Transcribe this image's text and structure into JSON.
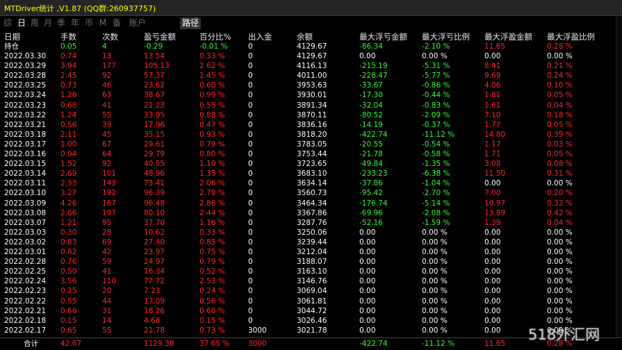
{
  "title": "MTDriver统计 ,V1.87 (QQ群:260937757)",
  "tabs": [
    "综",
    "日",
    "周",
    "月",
    "季",
    "年",
    "币",
    "M",
    "备",
    "账户",
    "路径"
  ],
  "active_tab": "日",
  "headers": [
    "日期",
    "手数",
    "次数",
    "盈亏金额",
    "百分比%",
    "出入金",
    "余额",
    "最大浮亏金额",
    "最大浮亏比例",
    "最大浮盈金额",
    "最大浮盈比例"
  ],
  "holding": [
    "持仓",
    "0.05",
    "4",
    "-0.29",
    "-0.01 %",
    "0",
    "4129.67",
    "-86.34",
    "-2.10 %",
    "11.65",
    "0.28 %"
  ],
  "rows": [
    [
      "2022.03.30",
      "0.74",
      "13",
      "13.54",
      "0.33 %",
      "0",
      "4129.67",
      "0.00",
      "0.00 %",
      "0.00",
      "0.00 %"
    ],
    [
      "2022.03.29",
      "3.94",
      "177",
      "105.13",
      "2.62 %",
      "0",
      "4116.13",
      "-215.19",
      "-5.31 %",
      "8.41",
      "0.21 %"
    ],
    [
      "2022.03.28",
      "2.45",
      "92",
      "57.37",
      "1.45 %",
      "0",
      "4011.00",
      "-228.47",
      "-5.77 %",
      "9.69",
      "0.24 %"
    ],
    [
      "2022.03.25",
      "0.73",
      "46",
      "23.62",
      "0.60 %",
      "0",
      "3953.63",
      "-33.67",
      "-0.86 %",
      "4.06",
      "0.10 %"
    ],
    [
      "2022.03.24",
      "1.26",
      "63",
      "38.67",
      "0.99 %",
      "0",
      "3930.01",
      "-17.30",
      "-0.44 %",
      "1.81",
      "0.05 %"
    ],
    [
      "2022.03.23",
      "0.68",
      "41",
      "21.23",
      "0.55 %",
      "0",
      "3891.34",
      "-32.04",
      "-0.83 %",
      "1.61",
      "0.04 %"
    ],
    [
      "2022.03.22",
      "1.24",
      "55",
      "33.95",
      "0.88 %",
      "0",
      "3870.11",
      "-80.52",
      "-2.09 %",
      "7.10",
      "0.18 %"
    ],
    [
      "2022.03.21",
      "0.56",
      "39",
      "17.96",
      "0.47 %",
      "0",
      "3836.16",
      "-14.19",
      "-0.37 %",
      "1.77",
      "0.05 %"
    ],
    [
      "2022.03.18",
      "2.11",
      "45",
      "35.15",
      "0.93 %",
      "0",
      "3818.20",
      "-422.74",
      "-11.12 %",
      "14.80",
      "0.39 %"
    ],
    [
      "2022.03.17",
      "1.00",
      "67",
      "29.61",
      "0.79 %",
      "0",
      "3783.05",
      "-20.55",
      "-0.54 %",
      "1.17",
      "0.03 %"
    ],
    [
      "2022.03.16",
      "0.94",
      "64",
      "29.79",
      "0.80 %",
      "0",
      "3753.44",
      "-21.78",
      "-0.58 %",
      "1.71",
      "0.05 %"
    ],
    [
      "2022.03.15",
      "1.52",
      "92",
      "40.55",
      "1.10 %",
      "0",
      "3723.65",
      "-49.84",
      "-1.35 %",
      "3.08",
      "0.08 %"
    ],
    [
      "2022.03.14",
      "2.69",
      "101",
      "48.96",
      "1.35 %",
      "0",
      "3683.10",
      "-233.23",
      "-6.38 %",
      "11.50",
      "0.31 %"
    ],
    [
      "2022.03.11",
      "2.33",
      "143",
      "73.41",
      "2.06 %",
      "0",
      "3634.14",
      "-37.86",
      "-1.04 %",
      "0.00",
      "0.00 %"
    ],
    [
      "2022.03.10",
      "3.27",
      "192",
      "96.39",
      "2.78 %",
      "0",
      "3560.73",
      "-95.42",
      "-2.70 %",
      "7.00",
      "0.20 %"
    ],
    [
      "2022.03.09",
      "4.26",
      "167",
      "96.48",
      "2.86 %",
      "0",
      "3464.34",
      "-176.74",
      "-5.14 %",
      "10.97",
      "0.32 %"
    ],
    [
      "2022.03.08",
      "2.66",
      "197",
      "80.10",
      "2.44 %",
      "0",
      "3367.86",
      "-69.96",
      "-2.08 %",
      "13.89",
      "0.42 %"
    ],
    [
      "2022.03.07",
      "1.21",
      "95",
      "37.70",
      "1.16 %",
      "0",
      "3287.76",
      "-52.16",
      "-1.59 %",
      "1.39",
      "0.04 %"
    ],
    [
      "2022.03.03",
      "0.30",
      "28",
      "10.62",
      "0.33 %",
      "0",
      "3250.06",
      "0.00",
      "0.00 %",
      "0.00",
      "0.00 %"
    ],
    [
      "2022.03.02",
      "0.83",
      "69",
      "27.40",
      "0.85 %",
      "0",
      "3239.44",
      "0.00",
      "0.00 %",
      "0.00",
      "0.00 %"
    ],
    [
      "2022.03.01",
      "0.82",
      "42",
      "23.97",
      "0.75 %",
      "0",
      "3212.04",
      "0.00",
      "0.00 %",
      "0.00",
      "0.00 %"
    ],
    [
      "2022.02.28",
      "0.76",
      "59",
      "24.97",
      "0.79 %",
      "0",
      "3188.07",
      "0.00",
      "0.00 %",
      "0.00",
      "0.00 %"
    ],
    [
      "2022.02.25",
      "0.50",
      "41",
      "16.34",
      "0.52 %",
      "0",
      "3163.10",
      "0.00",
      "0.00 %",
      "0.00",
      "0.00 %"
    ],
    [
      "2022.02.24",
      "3.56",
      "110",
      "77.72",
      "2.53 %",
      "0",
      "3146.76",
      "0.00",
      "0.00 %",
      "0.00",
      "0.00 %"
    ],
    [
      "2022.02.23",
      "0.25",
      "20",
      "7.23",
      "0.24 %",
      "0",
      "3069.04",
      "0.00",
      "0.00 %",
      "0.00",
      "0.00 %"
    ],
    [
      "2022.02.22",
      "0.55",
      "44",
      "17.09",
      "0.56 %",
      "0",
      "3061.81",
      "0.00",
      "0.00 %",
      "0.00",
      "0.00 %"
    ],
    [
      "2022.02.21",
      "0.66",
      "31",
      "18.26",
      "0.60 %",
      "0",
      "3044.72",
      "0.00",
      "0.00 %",
      "0.00",
      "0.00 %"
    ],
    [
      "2022.02.18",
      "0.15",
      "14",
      "4.68",
      "0.15 %",
      "0",
      "3026.46",
      "0.00",
      "0.00 %",
      "0.00",
      "0.00 %"
    ],
    [
      "2022.02.17",
      "0.65",
      "55",
      "21.78",
      "0.73 %",
      "3000",
      "3021.78",
      "0.00",
      "0.00 %",
      "0.00",
      "0.00 %"
    ]
  ],
  "total": [
    "合计",
    "42.67",
    "",
    "1129.38",
    "37.65 %",
    "3000",
    "",
    "-422.74",
    "-11.12 %",
    "11.65",
    "0.28 %"
  ],
  "watermark": "518外汇网",
  "colors": {
    "profit": "#ff2626",
    "loss": "#2bff2b",
    "neutral": "#ffffff",
    "title": "#ffff00"
  }
}
